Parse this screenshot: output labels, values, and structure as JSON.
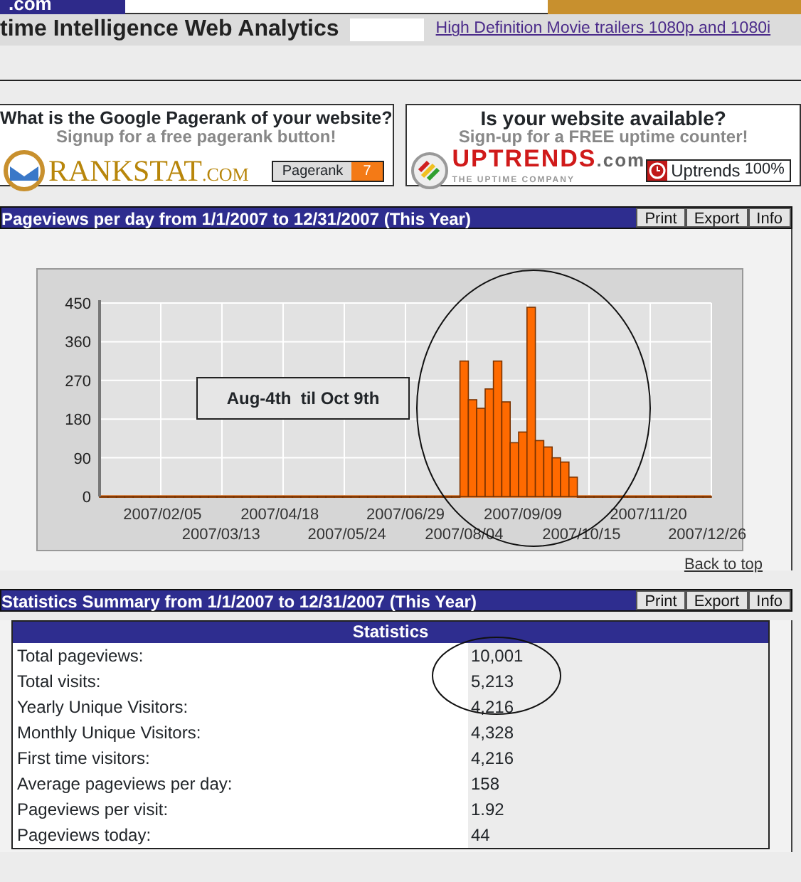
{
  "site_header": {
    "logo_text": ".com",
    "title": "time Intelligence Web Analytics",
    "link": "High Definition Movie trailers 1080p and 1080i"
  },
  "ads": [
    {
      "heading": "What is the Google Pagerank of your website?",
      "subheading": "Signup for a free pagerank button!",
      "brand": "RANKSTAT",
      "brand_suffix": ".COM",
      "badge_label": "Pagerank",
      "badge_value": "7"
    },
    {
      "heading": "Is your website available?",
      "subheading": "Sign-up for a FREE uptime counter!",
      "brand": "UPTRENDS",
      "brand_suffix": ".com",
      "tagline": "THE UPTIME COMPANY",
      "badge_label": "Uptrends",
      "badge_value": "100%"
    }
  ],
  "chart_panel": {
    "title": "Pageviews per day from 1/1/2007 to 12/31/2007 (This Year)",
    "buttons": [
      "Print",
      "Export",
      "Info"
    ],
    "annotation": "Aug-4th  til Oct 9th",
    "back_link": "Back to top",
    "chart_data": {
      "type": "bar",
      "categories": [
        null,
        null,
        null,
        null,
        null,
        null,
        null,
        "2007/02/05",
        null,
        null,
        null,
        null,
        null,
        null,
        "2007/03/13",
        null,
        null,
        null,
        null,
        null,
        null,
        "2007/04/18",
        null,
        null,
        null,
        null,
        null,
        null,
        null,
        "2007/05/24",
        null,
        null,
        null,
        null,
        null,
        null,
        "2007/06/29",
        null,
        null,
        null,
        null,
        null,
        null,
        "2007/08/04",
        null,
        null,
        null,
        null,
        null,
        null,
        "2007/09/09",
        null,
        null,
        null,
        null,
        null,
        null,
        "2007/10/15",
        null,
        null,
        null,
        null,
        null,
        null,
        null,
        "2007/11/20",
        null,
        null,
        null,
        null,
        null,
        null,
        "2007/12/26"
      ],
      "series": [
        {
          "color": "#ff6a00",
          "values": [
            0,
            0,
            0,
            0,
            0,
            0,
            0,
            0,
            0,
            0,
            0,
            0,
            0,
            0,
            0,
            0,
            0,
            0,
            0,
            0,
            0,
            0,
            0,
            0,
            0,
            0,
            0,
            0,
            0,
            0,
            0,
            0,
            0,
            0,
            0,
            0,
            0,
            0,
            0,
            0,
            0,
            0,
            0,
            315,
            225,
            205,
            250,
            315,
            220,
            125,
            150,
            440,
            130,
            115,
            90,
            80,
            45,
            0,
            0,
            0,
            0,
            0,
            0,
            0,
            0,
            0,
            0,
            0,
            0,
            0,
            0,
            0,
            0
          ]
        }
      ],
      "grid": true,
      "ylim": [
        0,
        450
      ],
      "yticks": [
        0,
        90,
        180,
        270,
        360,
        450
      ]
    }
  },
  "stats_panel": {
    "title": "Statistics Summary from 1/1/2007 to 12/31/2007 (This Year)",
    "buttons": [
      "Print",
      "Export",
      "Info"
    ],
    "table_title": "Statistics",
    "rows": [
      {
        "label": "Total pageviews:",
        "value": "10,001"
      },
      {
        "label": "Total visits:",
        "value": "5,213"
      },
      {
        "label": "Yearly Unique Visitors:",
        "value": "4,216"
      },
      {
        "label": "Monthly Unique Visitors:",
        "value": "4,328"
      },
      {
        "label": "First time visitors:",
        "value": "4,216"
      },
      {
        "label": "Average pageviews per day:",
        "value": "158"
      },
      {
        "label": "Pageviews per visit:",
        "value": "1.92"
      },
      {
        "label": "Pageviews today:",
        "value": "44"
      }
    ]
  }
}
